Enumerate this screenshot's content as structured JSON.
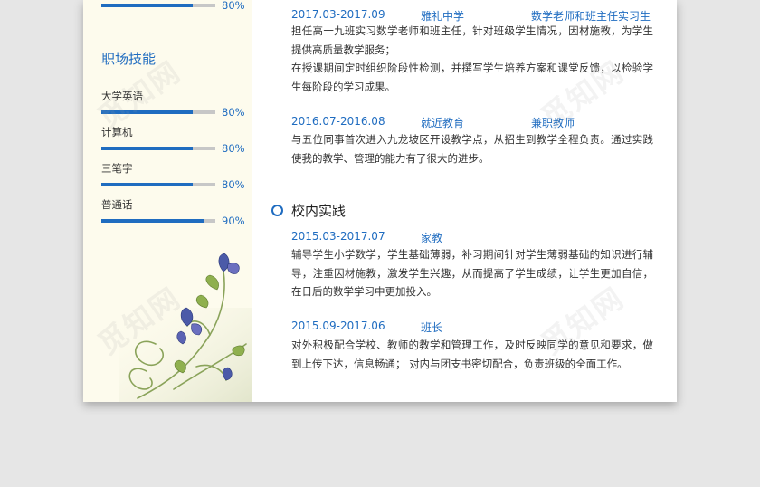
{
  "sidebar": {
    "top_skill": {
      "percent_label": "80%",
      "level": 0.8
    },
    "section_title": "职场技能",
    "skills": [
      {
        "name": "大学英语",
        "percent_label": "80%",
        "level": 0.8
      },
      {
        "name": "计算机",
        "percent_label": "80%",
        "level": 0.8
      },
      {
        "name": "三笔字",
        "percent_label": "80%",
        "level": 0.8
      },
      {
        "name": "普通话",
        "percent_label": "90%",
        "level": 0.9
      }
    ]
  },
  "work_entries": [
    {
      "date": "2017.03-2017.09",
      "org": "雅礼中学",
      "role": "数学老师和班主任实习生",
      "desc": [
        "担任高一九班实习数学老师和班主任，针对班级学生情况，因材施教，为学生提供高质量教学服务；",
        "在授课期间定时组织阶段性检测，并撰写学生培养方案和课堂反馈，以检验学生每阶段的学习成果。"
      ]
    },
    {
      "date": "2016.07-2016.08",
      "org": "就近教育",
      "role": "兼职教师",
      "desc": [
        "与五位同事首次进入九龙坡区开设教学点，从招生到教学全程负责。通过实践使我的教学、管理的能力有了很大的进步。"
      ]
    }
  ],
  "campus_section": {
    "title": "校内实践",
    "entries": [
      {
        "date": "2015.03-2017.07",
        "role": "家教",
        "desc": [
          "辅导学生小学数学，学生基础薄弱，补习期间针对学生薄弱基础的知识进行辅导，注重因材施教，激发学生兴趣，从而提高了学生成绩，让学生更加自信，在日后的数学学习中更加投入。"
        ]
      },
      {
        "date": "2015.09-2017.06",
        "role": "班长",
        "desc": [
          "对外积极配合学校、教师的教学和管理工作，及时反映同学的意见和要求，做到上传下达，信息畅通； 对内与团支书密切配合，负责班级的全面工作。"
        ]
      }
    ]
  },
  "watermark": "觅知网",
  "colors": {
    "accent": "#1f6cc0",
    "sidebar_bg": "#fdfbed",
    "bar_track": "#c7c7c7"
  },
  "icons": {
    "section_marker": "circle-outline-icon",
    "decoration": "flower-vine-icon"
  }
}
